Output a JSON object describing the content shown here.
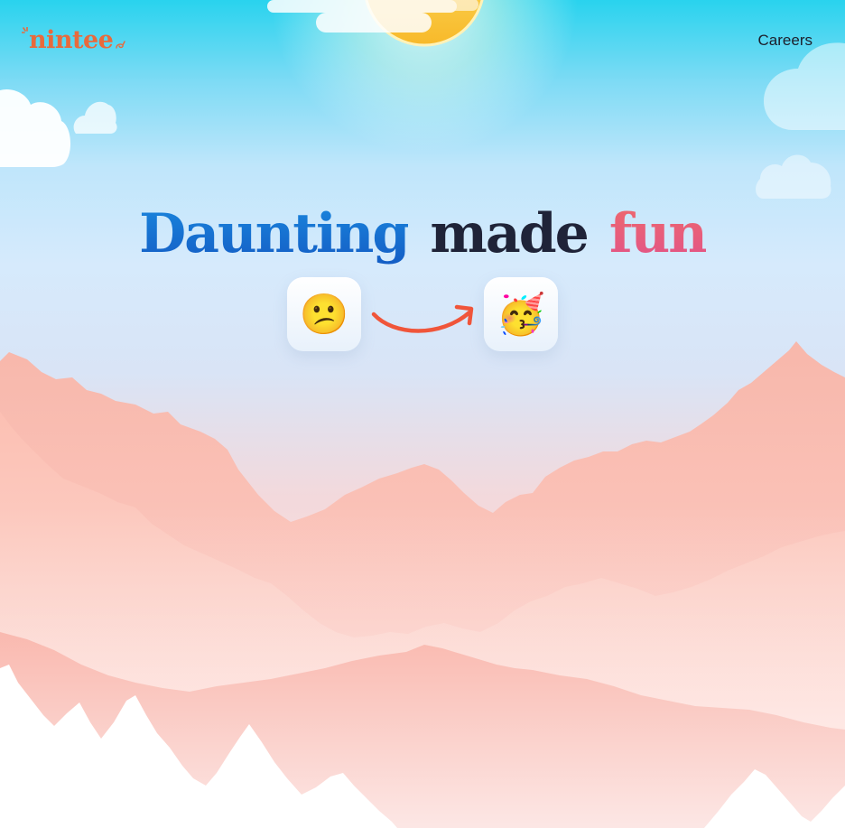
{
  "brand": {
    "name": "nintee",
    "color": "#e86a3c"
  },
  "nav": {
    "careers_label": "Careers"
  },
  "hero": {
    "headline": {
      "word1": "Daunting",
      "word2": "made",
      "word3": "fun"
    },
    "emoji_before": "😕",
    "emoji_after": "🥳",
    "arrow_color": "#f0553a"
  },
  "icons": {
    "sun": "sun-illustration",
    "clouds": "cloud-illustration",
    "mountains": "mountain-illustration",
    "arrow": "curved-arrow-icon"
  }
}
